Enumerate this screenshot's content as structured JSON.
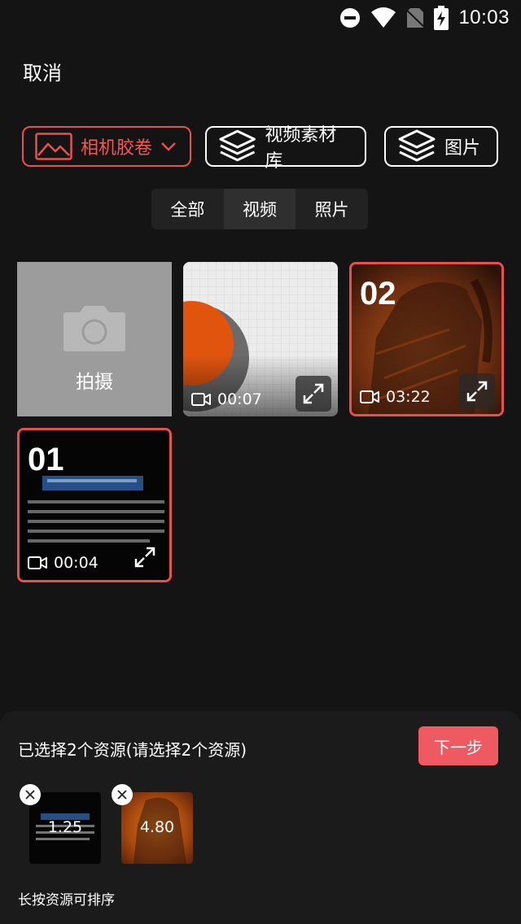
{
  "status_bar": {
    "time": "10:03",
    "icons": [
      "dnd-icon",
      "wifi-icon",
      "no-sim-icon",
      "battery-charging-icon"
    ]
  },
  "header": {
    "cancel_label": "取消"
  },
  "sources": {
    "camera_roll": {
      "label": "相机胶卷",
      "icon": "image-icon",
      "dropdown_icon": "chevron-down-icon"
    },
    "video_library": {
      "label": "视频素材库",
      "icon": "layers-icon"
    },
    "pictures": {
      "label": "图片",
      "icon": "layers-icon"
    }
  },
  "filter_tabs": [
    {
      "label": "全部"
    },
    {
      "label": "视频",
      "active": true
    },
    {
      "label": "照片"
    }
  ],
  "grid": {
    "camera_tile": {
      "label": "拍摄",
      "icon": "camera-icon"
    },
    "items": [
      {
        "duration": "00:07",
        "selected": false,
        "order": ""
      },
      {
        "duration": "03:22",
        "selected": true,
        "order": "02"
      },
      {
        "duration": "00:04",
        "selected": true,
        "order": "01"
      }
    ]
  },
  "selection": {
    "info": "已选择2个资源(请选择2个资源)",
    "next_label": "下一步",
    "items": [
      {
        "duration": "1.25"
      },
      {
        "duration": "4.80"
      }
    ],
    "hint": "长按资源可排序"
  },
  "colors": {
    "accent": "#e8504e",
    "next_button": "#ef5a62",
    "background": "#141414"
  }
}
